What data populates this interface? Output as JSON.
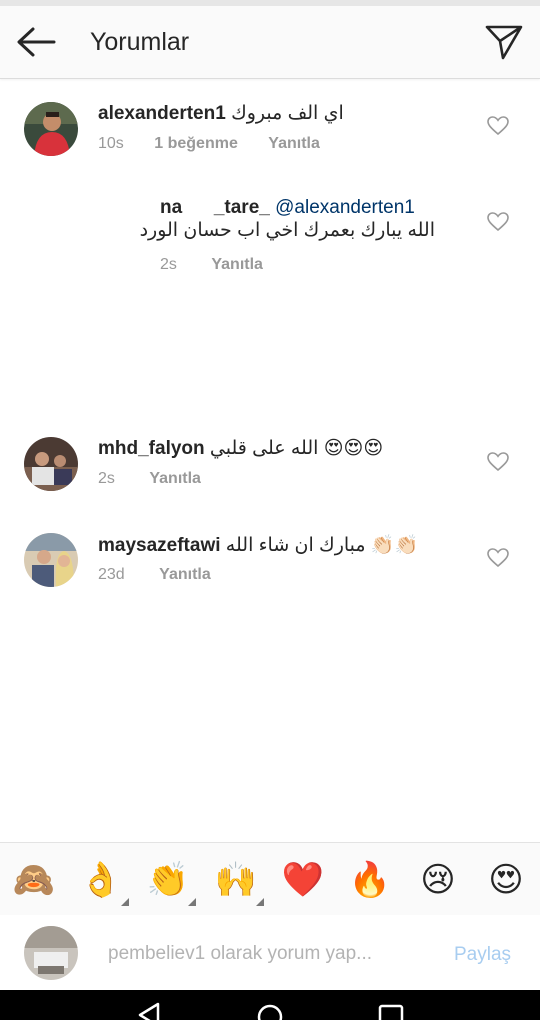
{
  "header": {
    "title": "Yorumlar"
  },
  "comments": [
    {
      "username": "alexanderten1",
      "text": "اي الف مبروك",
      "time": "10s",
      "likes": "1 beğenme",
      "reply": "Yanıtla"
    },
    {
      "username_partial": "na      _tare_",
      "mention": "@alexanderten1",
      "text": "الله يبارك بعمرك اخي اب حسان الورد",
      "time": "2s",
      "reply": "Yanıtla"
    },
    {
      "username": "mhd_falyon",
      "text": "الله على قلبي",
      "emojis": "😍😍😍",
      "time": "2s",
      "reply": "Yanıtla"
    },
    {
      "username": "maysazeftawi",
      "text": "مبارك ان شاء الله",
      "emojis": "👏🏻👏🏻",
      "time": "23d",
      "reply": "Yanıtla"
    }
  ],
  "emoji_bar": [
    "🙈",
    "👌",
    "👏",
    "🙌",
    "❤️",
    "🔥",
    "😢",
    "😍"
  ],
  "input": {
    "placeholder": "pembeliev1 olarak yorum yap...",
    "share": "Paylaş"
  },
  "colors": {
    "link": "#003569",
    "share_disabled": "#a8cdf0",
    "meta": "#999999",
    "heart_red": "#ed2f2f"
  }
}
